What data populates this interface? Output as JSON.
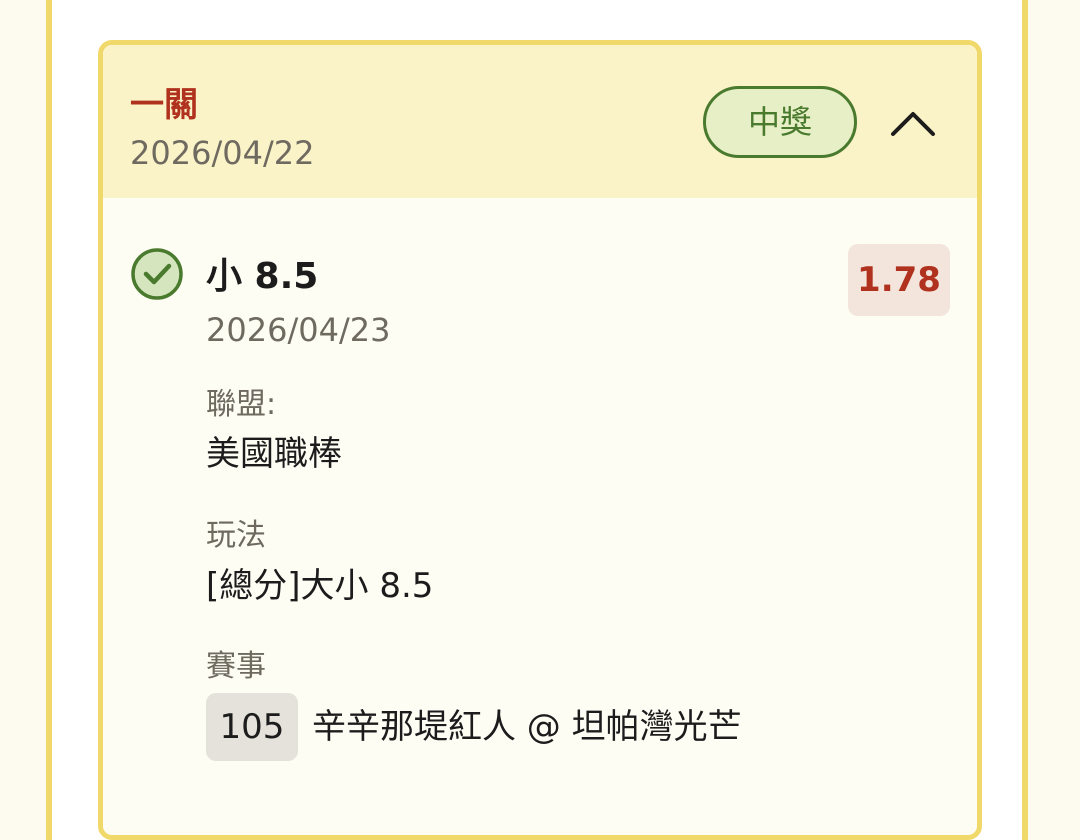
{
  "ticket": {
    "bet_type": "一關",
    "date": "2026/04/22",
    "status": "中獎",
    "colors": {
      "accent_red": "#b0321e",
      "win_green": "#4a7a2e",
      "header_bg": "#fbf3c8",
      "border": "#f0d96a"
    },
    "icons": {
      "collapse": "chevron-up-icon",
      "result": "check-circle-icon"
    }
  },
  "leg": {
    "selection": "小 8.5",
    "date": "2026/04/23",
    "odds": "1.78",
    "league_label": "聯盟:",
    "league_value": "美國職棒",
    "play_label": "玩法",
    "play_value": "[總分]大小 8.5",
    "event_label": "賽事",
    "event_number": "105",
    "event_name": "辛辛那堤紅人 @ 坦帕灣光芒"
  }
}
